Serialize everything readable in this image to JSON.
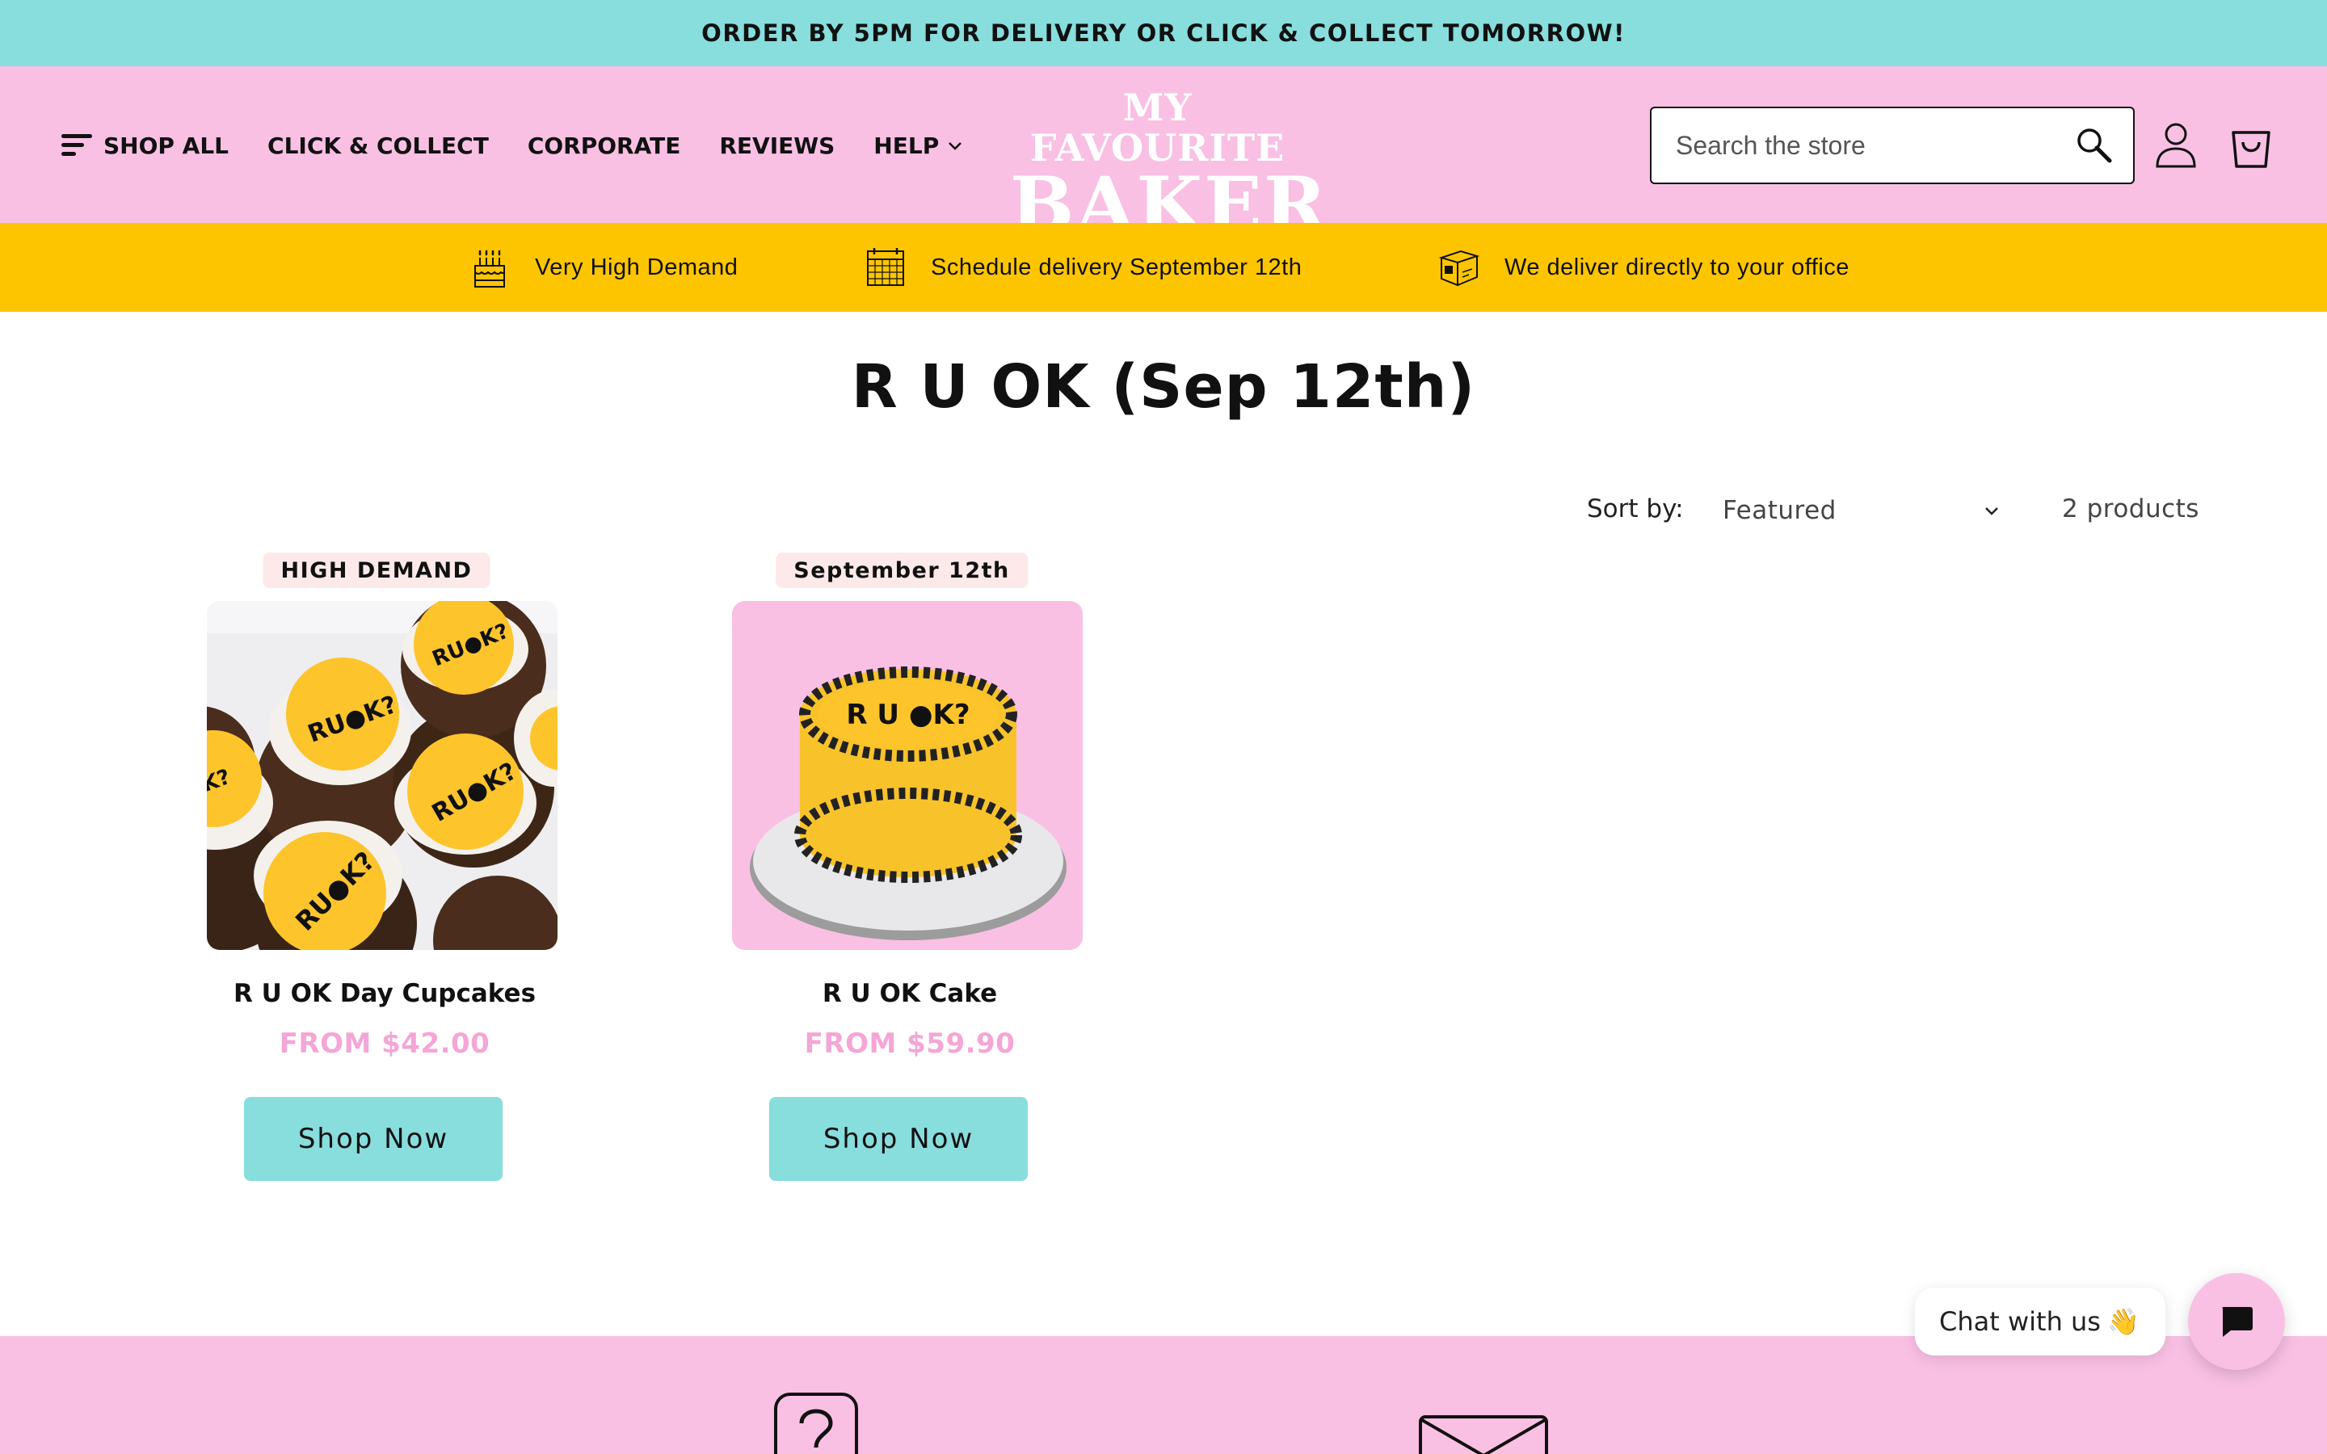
{
  "announcement": {
    "text": "ORDER BY 5PM FOR DELIVERY OR CLICK & COLLECT TOMORROW!"
  },
  "nav": {
    "shop_all": "SHOP ALL",
    "click_collect": "CLICK & COLLECT",
    "corporate": "CORPORATE",
    "reviews": "REVIEWS",
    "help": "HELP"
  },
  "logo": {
    "line1": "MY FAVOURITE",
    "line2": "BAKER"
  },
  "search": {
    "placeholder": "Search the store"
  },
  "infobar": {
    "item1": "Very High Demand",
    "item2": "Schedule delivery September 12th",
    "item3": "We deliver directly to your office"
  },
  "collection": {
    "title": "R U OK (Sep 12th)",
    "sort_label": "Sort by:",
    "sort_value": "Featured",
    "count": "2 products"
  },
  "products": [
    {
      "badge": "HIGH DEMAND",
      "name": "R U OK Day Cupcakes",
      "price": "FROM $42.00",
      "button": "Shop Now"
    },
    {
      "badge": "September 12th",
      "name": "R U OK Cake",
      "price": "FROM $59.90",
      "button": "Shop Now"
    }
  ],
  "chat": {
    "label": "Chat with us",
    "emoji": "👋"
  },
  "colors": {
    "announcement_bg": "#88dddd",
    "header_bg": "#f9c0e4",
    "infobar_bg": "#fdc500",
    "price": "#f4a6d6",
    "button_bg": "#88dddd"
  },
  "icons": [
    "menu-icon",
    "chevron-down-icon",
    "search-icon",
    "user-icon",
    "cart-icon",
    "cake-icon",
    "calendar-icon",
    "box-icon",
    "chat-icon",
    "help-icon",
    "mail-icon"
  ]
}
